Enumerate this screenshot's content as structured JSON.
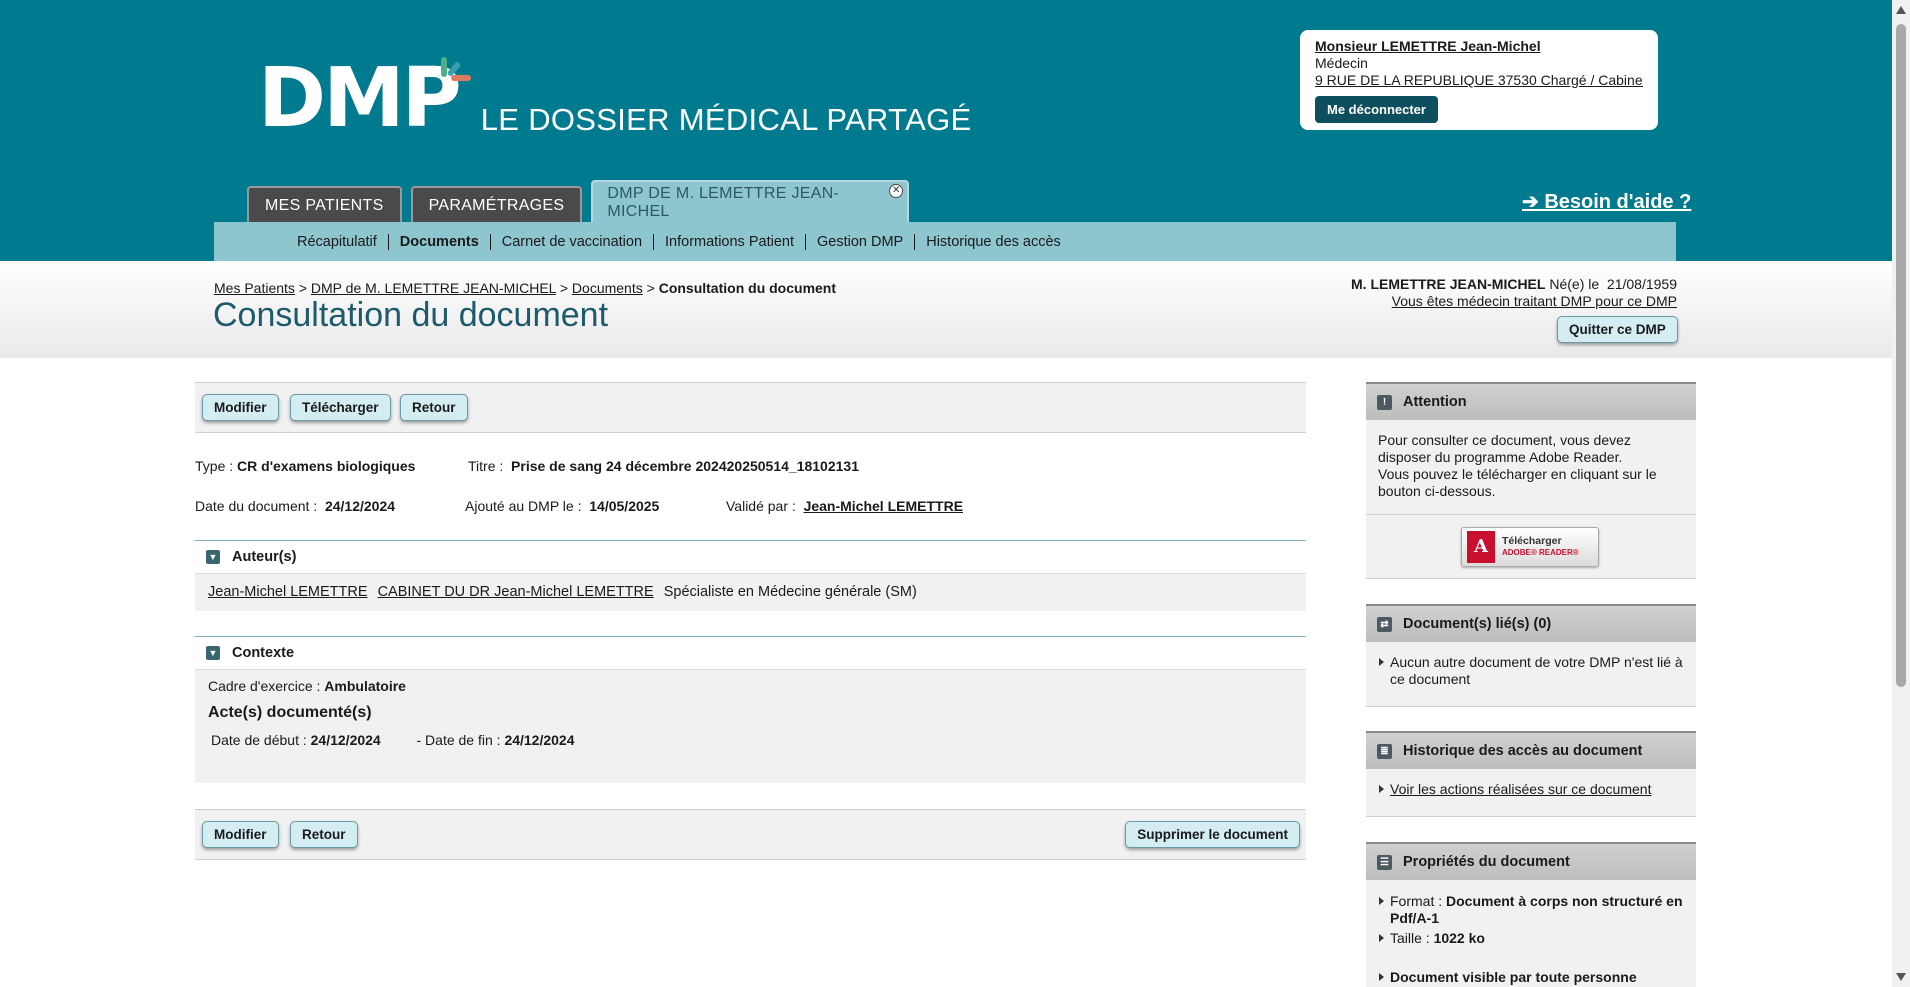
{
  "header": {
    "logo_text": "DMP",
    "tagline": "LE DOSSIER MÉDICAL PARTAGÉ",
    "colors": {
      "brand": "#007a8e",
      "accent_green": "#4caf8a",
      "accent_orange": "#e07a5f"
    }
  },
  "user": {
    "name": "Monsieur LEMETTRE Jean-Michel",
    "role": "Médecin",
    "address": "9 RUE DE LA REPUBLIQUE 37530 Chargé / Cabine...",
    "logout": "Me déconnecter"
  },
  "tabs": [
    {
      "label": "MES PATIENTS"
    },
    {
      "label": "PARAMÉTRAGES"
    },
    {
      "label": "DMP DE M. LEMETTRE JEAN-MICHEL",
      "close_icon": "close-icon"
    }
  ],
  "help": "➔ Besoin d'aide ?",
  "subnav": [
    "Récapitulatif",
    "Documents",
    "Carnet de vaccination",
    "Informations Patient",
    "Gestion DMP",
    "Historique des accès"
  ],
  "breadcrumb": {
    "items": [
      "Mes Patients",
      "DMP de M. LEMETTRE JEAN-MICHEL",
      "Documents"
    ],
    "sep": ">",
    "current": "Consultation du document"
  },
  "page_title": "Consultation du document",
  "patient": {
    "name": "M. LEMETTRE JEAN-MICHEL",
    "born_label": "Né(e) le",
    "born": "21/08/1959",
    "traitant": "Vous êtes médecin traitant DMP pour ce DMP",
    "quit": "Quitter ce DMP"
  },
  "toolbar_top": [
    "Modifier",
    "Télécharger",
    "Retour"
  ],
  "doc": {
    "type_label": "Type :",
    "type": "CR d'examens biologiques",
    "title_label": "Titre :",
    "title": "Prise de sang 24 décembre 202420250514_18102131",
    "date_label": "Date du document :",
    "date": "24/12/2024",
    "added_label": "Ajouté au DMP le :",
    "added": "14/05/2025",
    "validated_label": "Validé par :",
    "validated": "Jean-Michel LEMETTRE"
  },
  "authors": {
    "title": "Auteur(s)",
    "person": "Jean-Michel LEMETTRE",
    "org": "CABINET DU DR Jean-Michel LEMETTRE",
    "specialty": "Spécialiste en Médecine générale (SM)"
  },
  "context": {
    "title": "Contexte",
    "cadre_label": "Cadre d'exercice :",
    "cadre": "Ambulatoire",
    "actes_title": "Acte(s) documenté(s)",
    "start_label": "Date de début :",
    "start": "24/12/2024",
    "end_label": "- Date de fin :",
    "end": "24/12/2024"
  },
  "toolbar_bottom": {
    "modify": "Modifier",
    "back": "Retour",
    "delete": "Supprimer le document"
  },
  "panels": {
    "attention": {
      "title": "Attention",
      "text1": "Pour consulter ce document, vous devez disposer du programme Adobe Reader.",
      "text2": "Vous pouvez le télécharger en cliquant sur le bouton ci-dessous.",
      "adobe_line1": "Télécharger",
      "adobe_line2": "ADOBE® READER®"
    },
    "linked": {
      "title": "Document(s) lié(s) (0)",
      "item": "Aucun autre document de votre DMP n'est lié à ce document"
    },
    "history": {
      "title": "Historique des accès au document",
      "link": "Voir les actions réalisées sur ce document"
    },
    "props": {
      "title": "Propriétés du document",
      "format_label": "Format :",
      "format": "Document à corps non structuré en Pdf/A-1",
      "size_label": "Taille :",
      "size": "1022 ko",
      "visibility": "Document visible par toute personne"
    }
  }
}
